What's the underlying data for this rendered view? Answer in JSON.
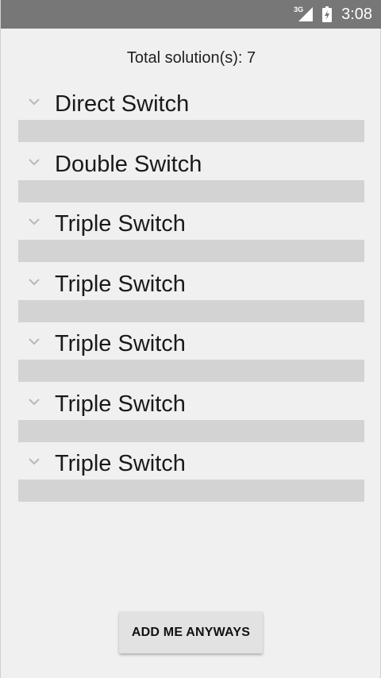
{
  "status_bar": {
    "network": "3G",
    "time": "3:08",
    "background": "#777777"
  },
  "summary": {
    "text": "Total solution(s): 7"
  },
  "solutions": [
    {
      "label": "Direct Switch",
      "icon": "chevron-down-icon"
    },
    {
      "label": "Double Switch",
      "icon": "chevron-down-icon"
    },
    {
      "label": "Triple Switch",
      "icon": "chevron-down-icon"
    },
    {
      "label": "Triple Switch",
      "icon": "chevron-down-icon"
    },
    {
      "label": "Triple Switch",
      "icon": "chevron-down-icon"
    },
    {
      "label": "Triple Switch",
      "icon": "chevron-down-icon"
    },
    {
      "label": "Triple Switch",
      "icon": "chevron-down-icon"
    }
  ],
  "actions": {
    "add_label": "ADD ME ANYWAYS"
  },
  "colors": {
    "background": "#f0f0f0",
    "bar": "#d3d3d3",
    "button": "#e2e2e2"
  }
}
